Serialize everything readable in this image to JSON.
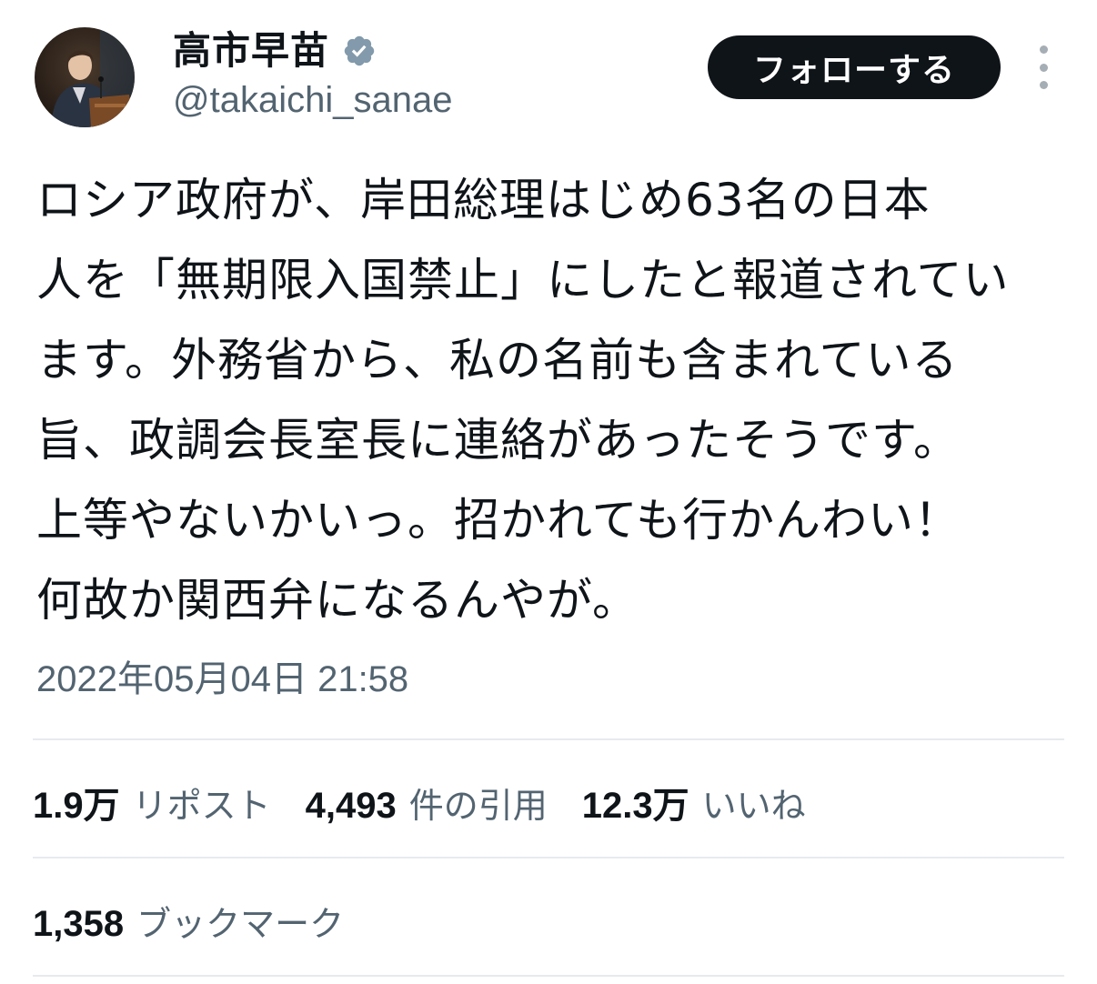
{
  "author": {
    "display_name": "高市早苗",
    "handle": "@takaichi_sanae",
    "verified_icon": "verified-badge-icon",
    "avatar": "profile-photo"
  },
  "follow_button": {
    "label": "フォローする"
  },
  "more_menu": {
    "icon": "more-vertical-icon"
  },
  "tweet": {
    "lines": [
      "ロシア政府が、岸田総理はじめ63名の日本",
      "人を「無期限入国禁止」にしたと報道されてい",
      "ます。外務省から、私の名前も含まれている",
      "旨、政調会長室長に連絡があったそうです。",
      "上等やないかいっ。招かれても行かんわい！",
      "何故か関西弁になるんやが。"
    ],
    "timestamp": "2022年05月04日 21:58"
  },
  "stats": {
    "reposts": {
      "value": "1.9万",
      "label": "リポスト"
    },
    "quotes": {
      "value": "4,493",
      "label": "件の引用"
    },
    "likes": {
      "value": "12.3万",
      "label": "いいね"
    },
    "bookmarks": {
      "value": "1,358",
      "label": "ブックマーク"
    }
  },
  "colors": {
    "text_primary": "#0f1419",
    "text_secondary": "#536471",
    "button_bg": "#0f1419",
    "divider": "#e7eaed",
    "verified_badge": "#829aab"
  }
}
